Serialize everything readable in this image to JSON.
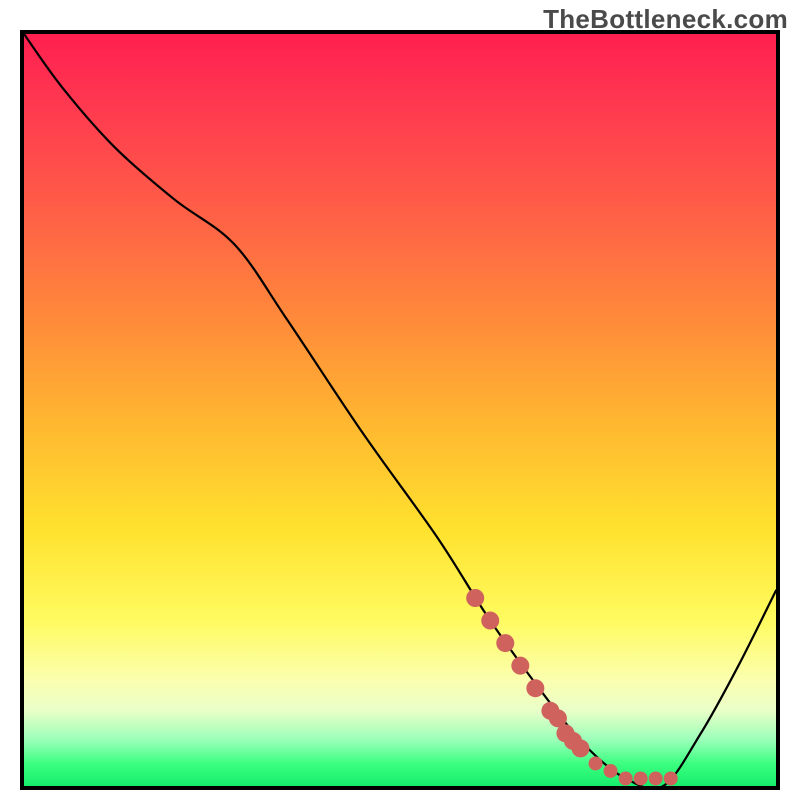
{
  "watermark_text": "TheBottleneck.com",
  "chart_data": {
    "type": "line",
    "title": "",
    "xlabel": "",
    "ylabel": "",
    "xlim": [
      0,
      100
    ],
    "ylim": [
      0,
      100
    ],
    "grid": false,
    "legend": false,
    "series": [
      {
        "name": "curve",
        "color": "#000000",
        "x": [
          0,
          5,
          12,
          20,
          28,
          35,
          45,
          55,
          62,
          70,
          75,
          80,
          85,
          90,
          95,
          100
        ],
        "values": [
          100,
          93,
          85,
          78,
          72,
          62,
          47,
          33,
          22,
          11,
          5,
          1,
          0,
          7,
          16,
          26
        ]
      },
      {
        "name": "highlight-dots",
        "color": "#d0625d",
        "x": [
          60,
          62,
          64,
          66,
          68,
          70,
          71,
          72,
          73,
          74,
          76,
          78,
          80,
          82,
          84,
          86
        ],
        "values": [
          25,
          22,
          19,
          16,
          13,
          10,
          9,
          7,
          6,
          5,
          3,
          2,
          1,
          1,
          1,
          1
        ]
      }
    ],
    "annotations": []
  }
}
